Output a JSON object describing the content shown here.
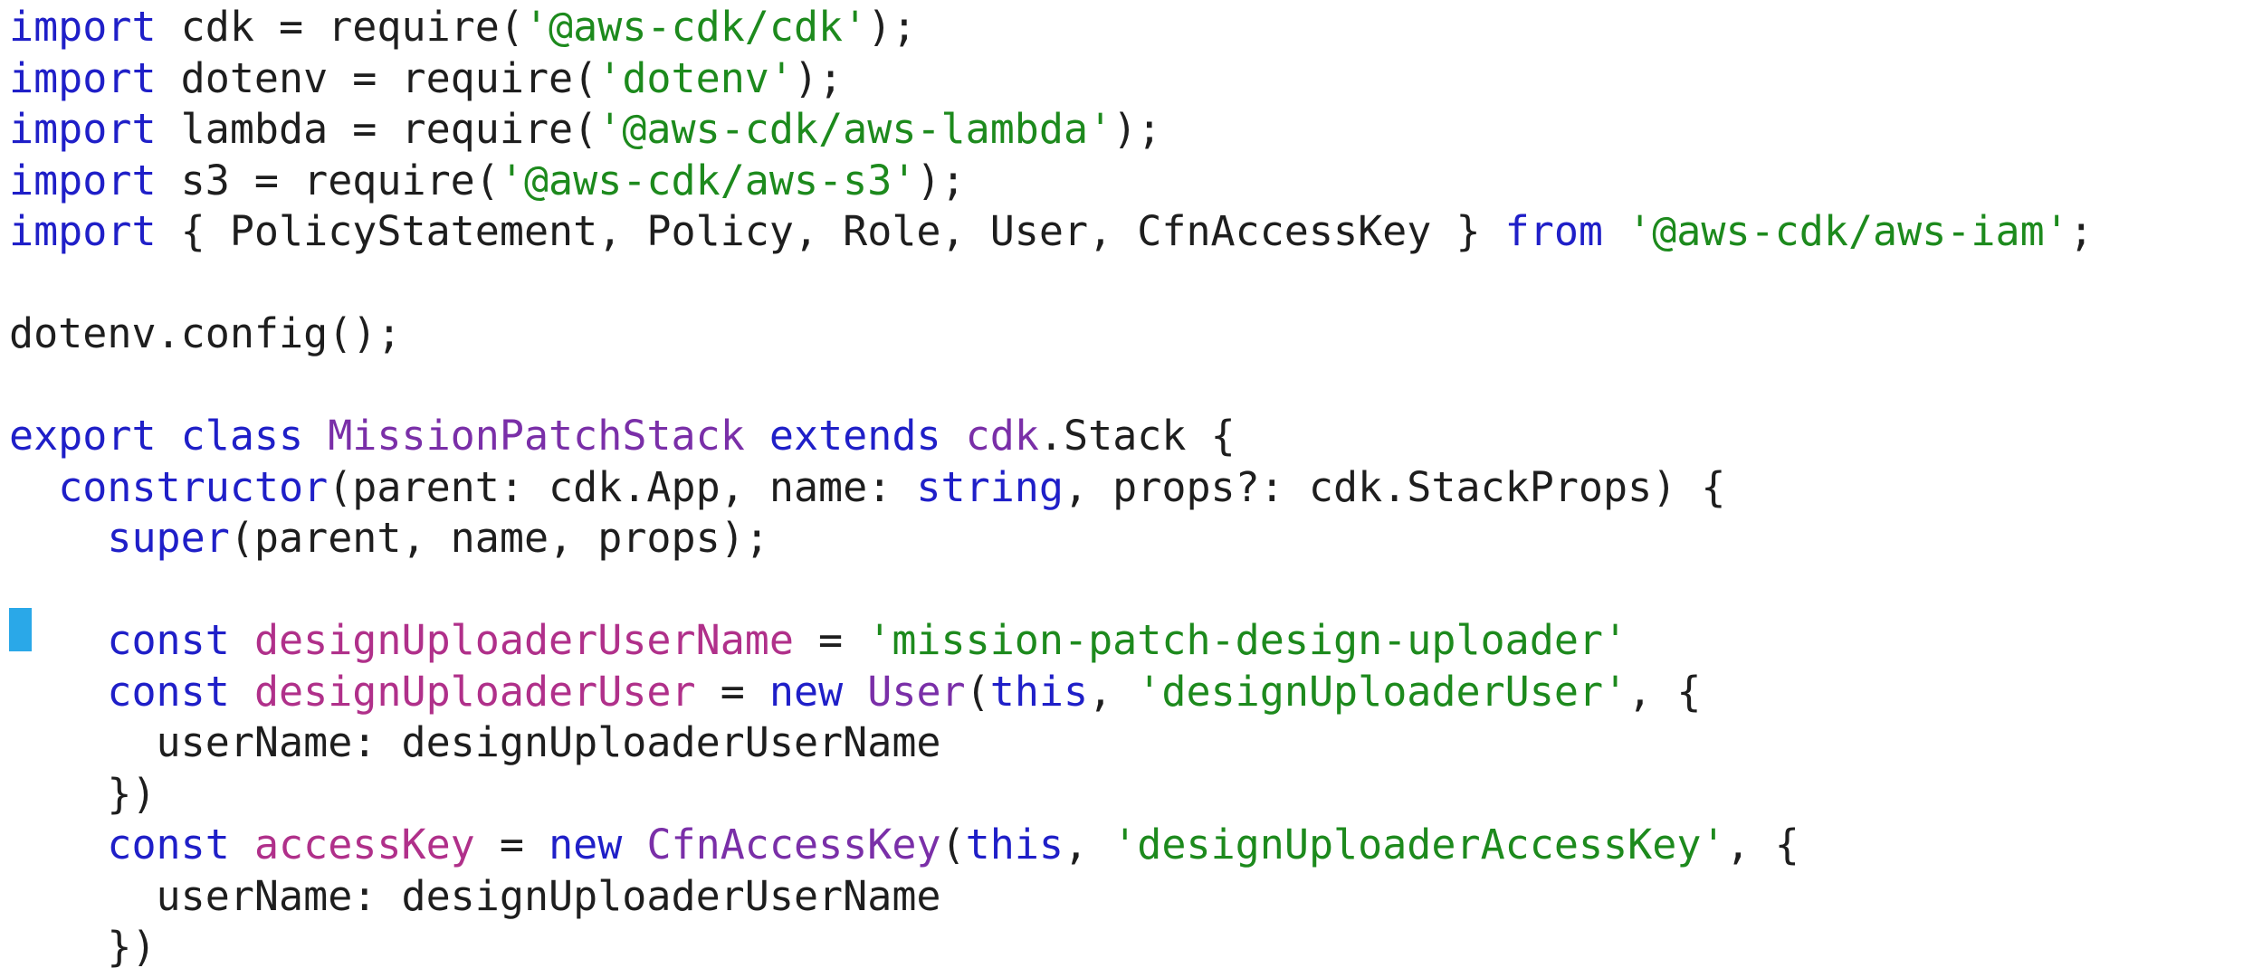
{
  "editor": {
    "language": "typescript",
    "colors": {
      "background": "#ffffff",
      "default": "#1e1e1e",
      "keyword": "#1f1fc8",
      "string": "#1d8a1d",
      "class": "#7a2fa8",
      "variable": "#b0308a",
      "cursor": "#2aa8e8"
    },
    "cursor_line": 12,
    "lines": [
      [
        [
          "keyword",
          "import"
        ],
        [
          "default",
          " cdk = require("
        ],
        [
          "string",
          "'@aws-cdk/cdk'"
        ],
        [
          "default",
          ");"
        ]
      ],
      [
        [
          "keyword",
          "import"
        ],
        [
          "default",
          " dotenv = require("
        ],
        [
          "string",
          "'dotenv'"
        ],
        [
          "default",
          ");"
        ]
      ],
      [
        [
          "keyword",
          "import"
        ],
        [
          "default",
          " lambda = require("
        ],
        [
          "string",
          "'@aws-cdk/aws-lambda'"
        ],
        [
          "default",
          ");"
        ]
      ],
      [
        [
          "keyword",
          "import"
        ],
        [
          "default",
          " s3 = require("
        ],
        [
          "string",
          "'@aws-cdk/aws-s3'"
        ],
        [
          "default",
          ");"
        ]
      ],
      [
        [
          "keyword",
          "import"
        ],
        [
          "default",
          " { PolicyStatement, Policy, Role, User, CfnAccessKey } "
        ],
        [
          "keyword",
          "from"
        ],
        [
          "default",
          " "
        ],
        [
          "string",
          "'@aws-cdk/aws-iam'"
        ],
        [
          "default",
          ";"
        ]
      ],
      [],
      [
        [
          "default",
          "dotenv.config();"
        ]
      ],
      [],
      [
        [
          "keyword",
          "export"
        ],
        [
          "default",
          " "
        ],
        [
          "keyword",
          "class"
        ],
        [
          "default",
          " "
        ],
        [
          "class",
          "MissionPatchStack"
        ],
        [
          "default",
          " "
        ],
        [
          "keyword",
          "extends"
        ],
        [
          "default",
          " "
        ],
        [
          "class",
          "cdk"
        ],
        [
          "default",
          ".Stack {"
        ]
      ],
      [
        [
          "default",
          "  "
        ],
        [
          "keyword",
          "constructor"
        ],
        [
          "default",
          "(parent: cdk.App, name: "
        ],
        [
          "keyword",
          "string"
        ],
        [
          "default",
          ", props?: cdk.StackProps) {"
        ]
      ],
      [
        [
          "default",
          "    "
        ],
        [
          "keyword",
          "super"
        ],
        [
          "default",
          "(parent, name, props);"
        ]
      ],
      [],
      [
        [
          "default",
          "    "
        ],
        [
          "keyword",
          "const"
        ],
        [
          "default",
          " "
        ],
        [
          "variable",
          "designUploaderUserName"
        ],
        [
          "default",
          " = "
        ],
        [
          "string",
          "'mission-patch-design-uploader'"
        ]
      ],
      [
        [
          "default",
          "    "
        ],
        [
          "keyword",
          "const"
        ],
        [
          "default",
          " "
        ],
        [
          "variable",
          "designUploaderUser"
        ],
        [
          "default",
          " = "
        ],
        [
          "keyword",
          "new"
        ],
        [
          "default",
          " "
        ],
        [
          "class",
          "User"
        ],
        [
          "default",
          "("
        ],
        [
          "keyword",
          "this"
        ],
        [
          "default",
          ", "
        ],
        [
          "string",
          "'designUploaderUser'"
        ],
        [
          "default",
          ", {"
        ]
      ],
      [
        [
          "default",
          "      userName: designUploaderUserName"
        ]
      ],
      [
        [
          "default",
          "    })"
        ]
      ],
      [
        [
          "default",
          "    "
        ],
        [
          "keyword",
          "const"
        ],
        [
          "default",
          " "
        ],
        [
          "variable",
          "accessKey"
        ],
        [
          "default",
          " = "
        ],
        [
          "keyword",
          "new"
        ],
        [
          "default",
          " "
        ],
        [
          "class",
          "CfnAccessKey"
        ],
        [
          "default",
          "("
        ],
        [
          "keyword",
          "this"
        ],
        [
          "default",
          ", "
        ],
        [
          "string",
          "'designUploaderAccessKey'"
        ],
        [
          "default",
          ", {"
        ]
      ],
      [
        [
          "default",
          "      userName: designUploaderUserName"
        ]
      ],
      [
        [
          "default",
          "    })"
        ]
      ]
    ]
  }
}
